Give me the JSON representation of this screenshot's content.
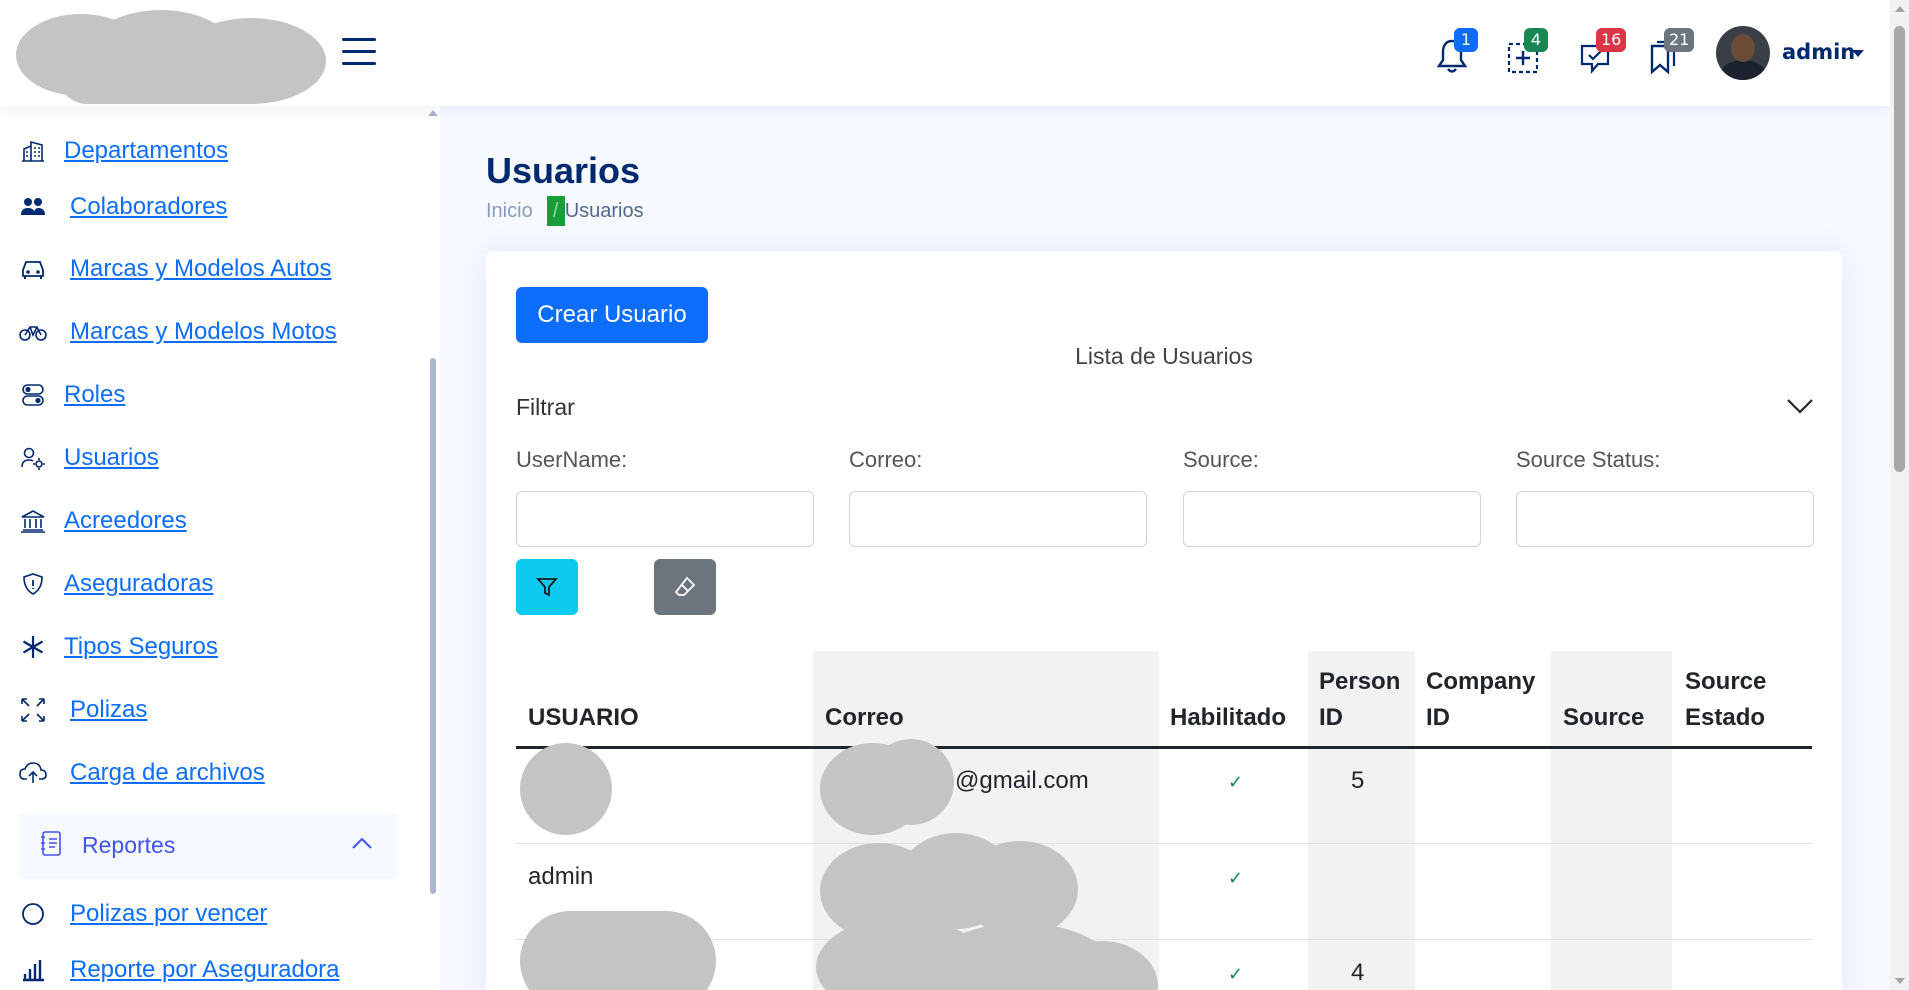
{
  "header": {
    "logo_text": "",
    "notifications": [
      {
        "icon": "bell-icon",
        "count": "1",
        "color": "#0d6efd"
      },
      {
        "icon": "plus-square-dashed-icon",
        "count": "4",
        "color": "#198754"
      },
      {
        "icon": "chat-check-icon",
        "count": "16",
        "color": "#dc3545"
      },
      {
        "icon": "bookmarks-icon",
        "count": "21",
        "color": "#6c757d"
      }
    ],
    "user_name": "admin"
  },
  "sidebar": {
    "items": [
      {
        "label": "Departamentos",
        "icon": "building-icon"
      },
      {
        "label": "Colaboradores",
        "icon": "people-icon"
      },
      {
        "label": "Marcas y Modelos Autos",
        "icon": "car-icon"
      },
      {
        "label": "Marcas y Modelos Motos",
        "icon": "bicycle-icon"
      },
      {
        "label": "Roles",
        "icon": "toggles-icon"
      },
      {
        "label": "Usuarios",
        "icon": "person-gear-icon"
      },
      {
        "label": "Acreedores",
        "icon": "bank-icon"
      },
      {
        "label": "Aseguradoras",
        "icon": "shield-icon"
      },
      {
        "label": "Tipos Seguros",
        "icon": "asterisk-icon"
      },
      {
        "label": "Polizas",
        "icon": "arrows-fullscreen-icon"
      },
      {
        "label": "Carga de archivos",
        "icon": "cloud-upload-icon"
      }
    ],
    "reportes": {
      "label": "Reportes",
      "icon": "journal-text-icon",
      "expanded": true
    },
    "report_items": [
      {
        "label": "Polizas por vencer",
        "icon": "circle-icon"
      },
      {
        "label": "Reporte por Aseguradora",
        "icon": "bar-chart-icon"
      }
    ]
  },
  "main": {
    "title": "Usuarios",
    "breadcrumb": {
      "home": "Inicio",
      "separator": "/",
      "current": "Usuarios"
    },
    "create_button": "Crear Usuario",
    "list_title": "Lista de Usuarios",
    "filter": {
      "label": "Filtrar",
      "fields": [
        {
          "label": "UserName:",
          "value": "",
          "placeholder": ""
        },
        {
          "label": "Correo:",
          "value": "",
          "placeholder": ""
        },
        {
          "label": "Source:",
          "value": "",
          "placeholder": ""
        },
        {
          "label": "Source Status:",
          "value": "",
          "placeholder": ""
        }
      ],
      "filter_icon": "funnel-icon",
      "clear_icon": "eraser-icon"
    },
    "table": {
      "headers": {
        "usuario": "USUARIO",
        "correo": "Correo",
        "habilitado": "Habilitado",
        "person_id_1": "Person",
        "person_id_2": "ID",
        "company_id_1": "Company",
        "company_id_2": "ID",
        "source": "Source",
        "source_estado_1": "Source",
        "source_estado_2": "Estado"
      },
      "rows": [
        {
          "usuario": "",
          "correo": "@gmail.com",
          "habilitado": "✓",
          "person_id": "5",
          "company_id": "",
          "source": "",
          "source_estado": ""
        },
        {
          "usuario": "admin",
          "correo": "",
          "habilitado": "✓",
          "person_id": "",
          "company_id": "",
          "source": "",
          "source_estado": ""
        },
        {
          "usuario": "",
          "correo": "",
          "habilitado": "✓",
          "person_id": "4",
          "company_id": "",
          "source": "",
          "source_estado": ""
        }
      ]
    }
  },
  "colors": {
    "primary": "#0d6efd",
    "navy": "#012970",
    "info": "#0dcaf0",
    "secondary": "#6c757d",
    "success": "#198754",
    "danger": "#dc3545",
    "redacted": "#c4c4c4"
  }
}
